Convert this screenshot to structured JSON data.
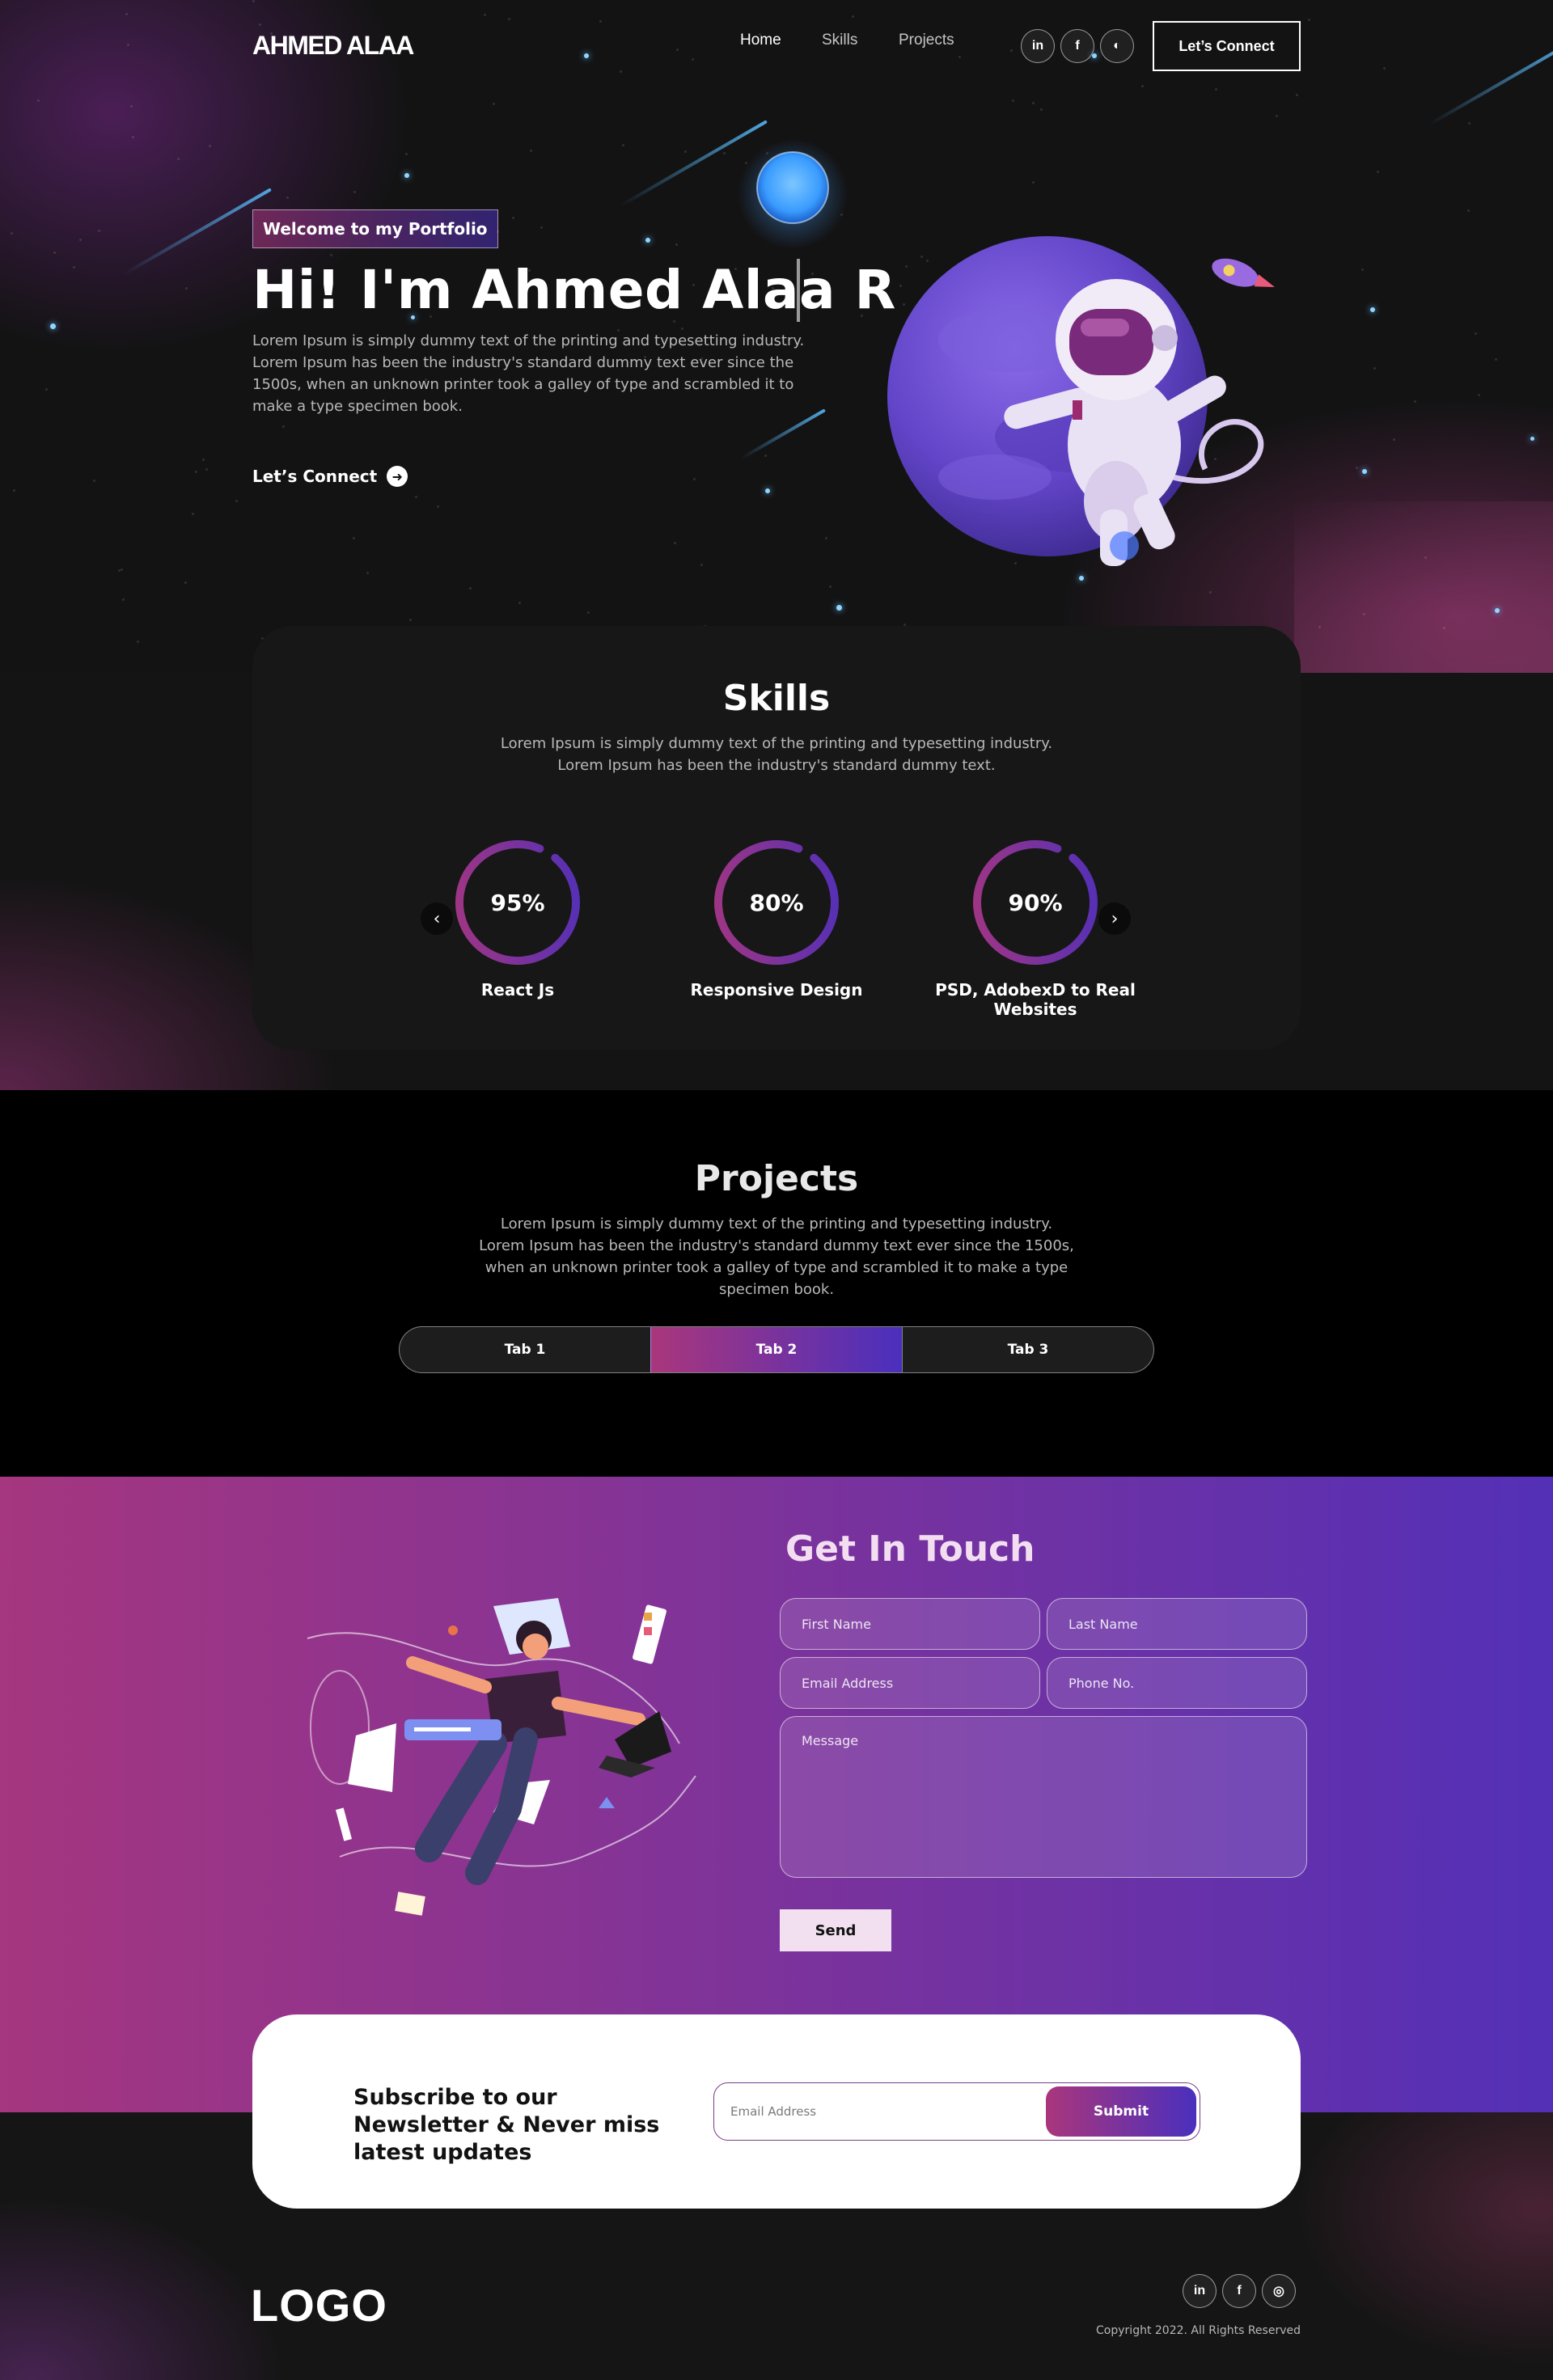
{
  "nav": {
    "brand": "AHMED ALAA",
    "links": [
      "Home",
      "Skills",
      "Projects"
    ],
    "active": "Home",
    "social": [
      {
        "icon": "linkedin-icon",
        "glyph": "in"
      },
      {
        "icon": "facebook-icon",
        "glyph": "f"
      },
      {
        "icon": "github-icon",
        "glyph": "◐"
      }
    ],
    "cta": "Let’s Connect"
  },
  "hero": {
    "tagline": "Welcome to my Portfolio",
    "title": "Hi! I'm Ahmed Alaa R",
    "description": "Lorem Ipsum is simply dummy text of the printing and typesetting industry. Lorem Ipsum has been the industry's standard dummy text ever since the 1500s, when an unknown printer took a galley of type and scrambled it to make a type specimen book.",
    "cta": "Let’s Connect"
  },
  "skills": {
    "title": "Skills",
    "description": "Lorem Ipsum is simply dummy text of the printing and typesetting industry. Lorem Ipsum has been the industry's standard dummy text.",
    "items": [
      {
        "label": "React Js",
        "value": "95%"
      },
      {
        "label": "Responsive Design",
        "value": "80%"
      },
      {
        "label": "PSD, AdobexD to Real Websites",
        "value": "90%"
      }
    ]
  },
  "projects": {
    "title": "Projects",
    "description": "Lorem Ipsum is simply dummy text of the printing and typesetting industry. Lorem Ipsum has been the industry's standard dummy text ever since the 1500s, when an unknown printer took a galley of type and scrambled it to make a type specimen book.",
    "tabs": [
      "Tab 1",
      "Tab 2",
      "Tab 3"
    ],
    "active_tab": "Tab 2"
  },
  "contact": {
    "title": "Get In Touch",
    "fields": {
      "first_name": "First Name",
      "last_name": "Last Name",
      "email": "Email Address",
      "phone": "Phone No.",
      "message": "Message"
    },
    "send": "Send"
  },
  "newsletter": {
    "title": "Subscribe to our Newsletter & Never miss latest updates",
    "placeholder": "Email Address",
    "submit": "Submit"
  },
  "footer": {
    "logo": "LOGO",
    "social": [
      {
        "icon": "linkedin-icon",
        "glyph": "in"
      },
      {
        "icon": "facebook-icon",
        "glyph": "f"
      },
      {
        "icon": "instagram-icon",
        "glyph": "◎"
      }
    ],
    "copyright": "Copyright 2022. All Rights Reserved"
  },
  "colors": {
    "accent_pink": "#aa367c",
    "accent_purple": "#4a2fbd",
    "background": "#121212"
  }
}
